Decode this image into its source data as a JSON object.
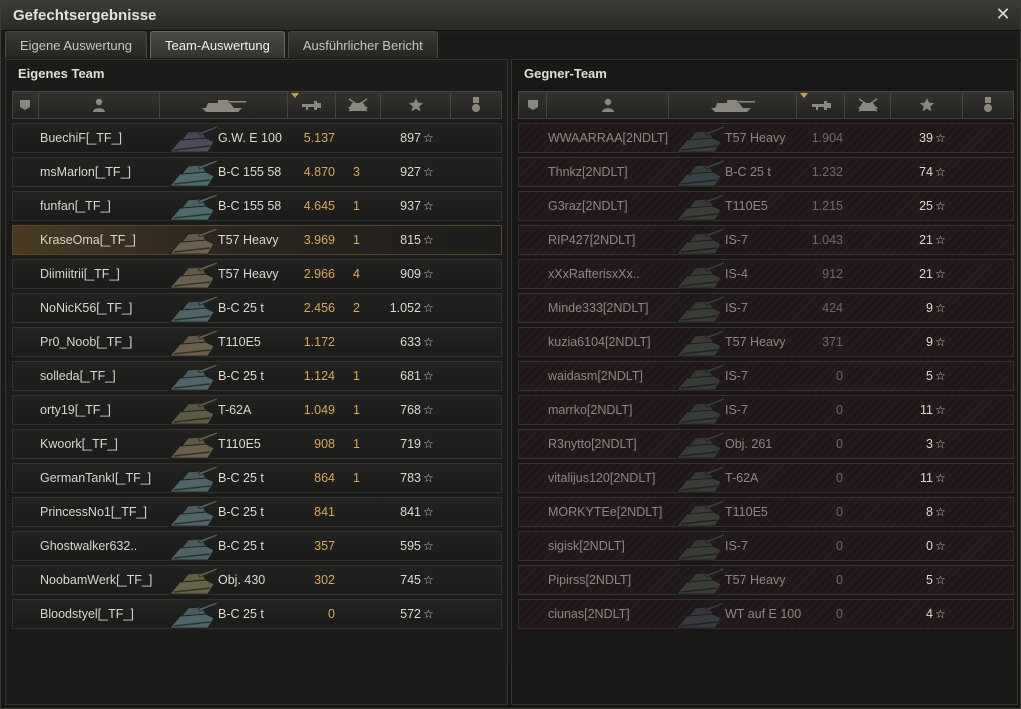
{
  "window": {
    "title": "Gefechtsergebnisse"
  },
  "tabs": [
    {
      "label": "Eigene Auswertung",
      "active": false
    },
    {
      "label": "Team-Auswertung",
      "active": true
    },
    {
      "label": "Ausführlicher Bericht",
      "active": false
    }
  ],
  "columns": [
    "squad-icon",
    "player-icon",
    "tank-icon",
    "damage-icon",
    "kills-icon",
    "xp-star-icon",
    "medal-icon"
  ],
  "colors": {
    "accent": "#d6a85a",
    "highlight_row": "#4a3a22",
    "enemy_row": "#241c1c"
  },
  "own_team": {
    "title": "Eigenes Team",
    "rows": [
      {
        "player": "BuechiF[_TF_]",
        "vehicle": "G.W. E 100",
        "damage": "5.137",
        "kills": "",
        "xp": "897",
        "tank_color": "#4a4c58"
      },
      {
        "player": "msMarlon[_TF_]",
        "vehicle": "B-C 155 58",
        "damage": "4.870",
        "kills": "3",
        "xp": "927",
        "tank_color": "#4f6a6a"
      },
      {
        "player": "funfan[_TF_]",
        "vehicle": "B-C 155 58",
        "damage": "4.645",
        "kills": "1",
        "xp": "937",
        "tank_color": "#4f6a6a"
      },
      {
        "player": "KraseOma[_TF_]",
        "vehicle": "T57 Heavy",
        "damage": "3.969",
        "kills": "1",
        "xp": "815",
        "tank_color": "#6a604c",
        "highlight": true
      },
      {
        "player": "Diimiitrii[_TF_]",
        "vehicle": "T57 Heavy",
        "damage": "2.966",
        "kills": "4",
        "xp": "909",
        "tank_color": "#6a604c"
      },
      {
        "player": "NoNicK56[_TF_]",
        "vehicle": "B-C 25 t",
        "damage": "2.456",
        "kills": "2",
        "xp": "1.052",
        "tank_color": "#4f6466"
      },
      {
        "player": "Pr0_Noob[_TF_]",
        "vehicle": "T110E5",
        "damage": "1.172",
        "kills": "",
        "xp": "633",
        "tank_color": "#6a604a"
      },
      {
        "player": "solleda[_TF_]",
        "vehicle": "B-C 25 t",
        "damage": "1.124",
        "kills": "1",
        "xp": "681",
        "tank_color": "#4f6466"
      },
      {
        "player": "orty19[_TF_]",
        "vehicle": "T-62A",
        "damage": "1.049",
        "kills": "1",
        "xp": "768",
        "tank_color": "#5c5c44"
      },
      {
        "player": "Kwoork[_TF_]",
        "vehicle": "T110E5",
        "damage": "908",
        "kills": "1",
        "xp": "719",
        "tank_color": "#6a604a"
      },
      {
        "player": "GermanTankI[_TF_]",
        "vehicle": "B-C 25 t",
        "damage": "864",
        "kills": "1",
        "xp": "783",
        "tank_color": "#4f6466"
      },
      {
        "player": "PrincessNo1[_TF_]",
        "vehicle": "B-C 25 t",
        "damage": "841",
        "kills": "",
        "xp": "841",
        "tank_color": "#4f6466"
      },
      {
        "player": "Ghostwalker632..",
        "vehicle": "B-C 25 t",
        "damage": "357",
        "kills": "",
        "xp": "595",
        "tank_color": "#4f6466"
      },
      {
        "player": "NoobamWerk[_TF_]",
        "vehicle": "Obj. 430",
        "damage": "302",
        "kills": "",
        "xp": "745",
        "tank_color": "#666448"
      },
      {
        "player": "Bloodstyel[_TF_]",
        "vehicle": "B-C 25 t",
        "damage": "0",
        "kills": "",
        "xp": "572",
        "tank_color": "#4f6466"
      }
    ]
  },
  "enemy_team": {
    "title": "Gegner-Team",
    "rows": [
      {
        "player": "WWAARRAA[2NDLT]",
        "vehicle": "T57 Heavy",
        "damage": "1.904",
        "xp": "39",
        "tank_color": "#3a3e38"
      },
      {
        "player": "Thnkz[2NDLT]",
        "vehicle": "B-C 25 t",
        "damage": "1.232",
        "xp": "74",
        "tank_color": "#364244"
      },
      {
        "player": "G3raz[2NDLT]",
        "vehicle": "T110E5",
        "damage": "1.215",
        "xp": "25",
        "tank_color": "#3a3e38"
      },
      {
        "player": "RIP427[2NDLT]",
        "vehicle": "IS-7",
        "damage": "1.043",
        "xp": "21",
        "tank_color": "#383c36"
      },
      {
        "player": "xXxRafterisxXx..",
        "vehicle": "IS-4",
        "damage": "912",
        "xp": "21",
        "tank_color": "#383c36"
      },
      {
        "player": "Minde333[2NDLT]",
        "vehicle": "IS-7",
        "damage": "424",
        "xp": "9",
        "tank_color": "#383c36"
      },
      {
        "player": "kuzia6104[2NDLT]",
        "vehicle": "T57 Heavy",
        "damage": "371",
        "xp": "9",
        "tank_color": "#3a3e38"
      },
      {
        "player": "waidasm[2NDLT]",
        "vehicle": "IS-7",
        "damage": "0",
        "xp": "5",
        "tank_color": "#383c36"
      },
      {
        "player": "marrko[2NDLT]",
        "vehicle": "IS-7",
        "damage": "0",
        "xp": "11",
        "tank_color": "#383c36"
      },
      {
        "player": "R3nytto[2NDLT]",
        "vehicle": "Obj. 261",
        "damage": "0",
        "xp": "3",
        "tank_color": "#383c36"
      },
      {
        "player": "vitalijus120[2NDLT]",
        "vehicle": "T-62A",
        "damage": "0",
        "xp": "11",
        "tank_color": "#383c36"
      },
      {
        "player": "MORKYTEe[2NDLT]",
        "vehicle": "T110E5",
        "damage": "0",
        "xp": "8",
        "tank_color": "#3a3e38"
      },
      {
        "player": "sigisk[2NDLT]",
        "vehicle": "IS-7",
        "damage": "0",
        "xp": "0",
        "tank_color": "#383c36"
      },
      {
        "player": "Pipirss[2NDLT]",
        "vehicle": "T57 Heavy",
        "damage": "0",
        "xp": "5",
        "tank_color": "#3a3e38"
      },
      {
        "player": "ciunas[2NDLT]",
        "vehicle": "WT auf E 100",
        "damage": "0",
        "xp": "4",
        "tank_color": "#363a40"
      }
    ]
  }
}
